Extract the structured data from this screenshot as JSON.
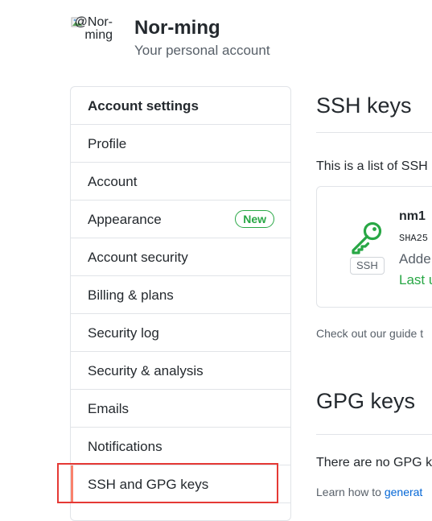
{
  "account": {
    "avatar_alt": "@Nor-ming",
    "name": "Nor-ming",
    "subtitle": "Your personal account"
  },
  "sidebar": {
    "header": "Account settings",
    "items": [
      {
        "label": "Profile"
      },
      {
        "label": "Account"
      },
      {
        "label": "Appearance",
        "badge": "New"
      },
      {
        "label": "Account security"
      },
      {
        "label": "Billing & plans"
      },
      {
        "label": "Security log"
      },
      {
        "label": "Security & analysis"
      },
      {
        "label": "Emails"
      },
      {
        "label": "Notifications"
      },
      {
        "label": "SSH and GPG keys",
        "selected": true
      }
    ]
  },
  "ssh": {
    "title": "SSH keys",
    "intro": "This is a list of SSH",
    "key": {
      "label": "SSH",
      "title": "nm1",
      "fingerprint": "SHA25",
      "added": "Adde",
      "last_used": "Last u"
    },
    "guide": "Check out our guide t"
  },
  "gpg": {
    "title": "GPG keys",
    "empty": "There are no GPG k",
    "learn_prefix": "Learn how to ",
    "learn_link": "generat"
  },
  "colors": {
    "accent_green": "#28a745",
    "link_blue": "#0366d6",
    "selected_bar": "#f9826c",
    "highlight_red": "#e53935"
  }
}
